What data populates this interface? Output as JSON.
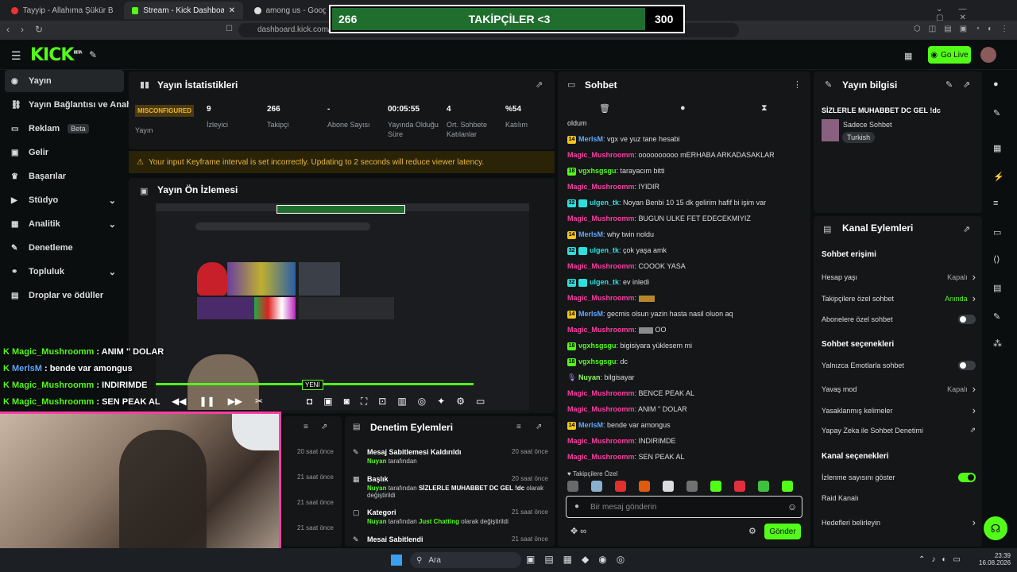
{
  "browser": {
    "tabs": [
      {
        "label": "Tayyip - Allahıma Şükür Bugün de"
      },
      {
        "label": "Stream - Kick Dashboard"
      },
      {
        "label": "among us - Google'da Ar"
      }
    ],
    "url": "dashboard.kick.com/str"
  },
  "follower_goal": {
    "current": "266",
    "label": "TAKİPÇİLER <3",
    "target": "300",
    "progress": 0.887
  },
  "topbar": {
    "logo": "KICK",
    "logo_sup": "BETA",
    "go_live": "Go Live"
  },
  "sidebar": {
    "items": [
      {
        "label": "Yayın",
        "icon": "broadcast-icon"
      },
      {
        "label": "Yayın Bağlantısı ve Anahtar",
        "icon": "link-icon"
      },
      {
        "label": "Reklam",
        "badge": "Beta",
        "icon": "ad-icon"
      },
      {
        "label": "Gelir",
        "icon": "revenue-icon"
      },
      {
        "label": "Başarılar",
        "icon": "trophy-icon"
      },
      {
        "label": "Stüdyo",
        "icon": "studio-icon"
      },
      {
        "label": "Analitik",
        "icon": "analytics-icon"
      },
      {
        "label": "Denetleme",
        "icon": "moderation-icon"
      },
      {
        "label": "Topluluk",
        "icon": "community-icon"
      },
      {
        "label": "Droplar ve ödüller",
        "icon": "drops-icon"
      }
    ]
  },
  "stats": {
    "title": "Yayın İstatistikleri",
    "status_badge": "MISCONFIGURED",
    "status_label": "Yayın",
    "items": [
      {
        "value": "9",
        "label": "İzleyici"
      },
      {
        "value": "266",
        "label": "Takipçi"
      },
      {
        "value": "-",
        "label": "Abone Sayısı"
      },
      {
        "value": "00:05:55",
        "label": "Yayında Olduğu Süre"
      },
      {
        "value": "4",
        "label": "Ort. Sohbete Katılanlar"
      },
      {
        "value": "%54",
        "label": "Katılım"
      }
    ],
    "warning": "Your input Keyframe interval is set incorrectly. Updating to 2 seconds will reduce viewer latency."
  },
  "preview": {
    "title": "Yayın Ön İzlemesi",
    "new_badge": "YENİ"
  },
  "overlay_chat": [
    {
      "user": "Magic_Mushroomm",
      "text": "ANIM \" DOLAR",
      "color": "green"
    },
    {
      "user": "MerlsM",
      "text": "bende var amongus",
      "color": "blue"
    },
    {
      "user": "Magic_Mushroomm",
      "text": "INDIRIMDE",
      "color": "green"
    },
    {
      "user": "Magic_Mushroomm",
      "text": "SEN PEAK AL",
      "color": "green"
    }
  ],
  "mod_history": {
    "times": [
      "20 saat önce",
      "21 saat önce",
      "21 saat önce",
      "21 saat önce"
    ]
  },
  "mod_actions": {
    "title": "Denetim Eylemleri",
    "items": [
      {
        "title": "Mesaj Sabitlemesi Kaldırıldı",
        "actor": "Nuyan",
        "suffix": "tarafından",
        "extra": "",
        "time": "20 saat önce"
      },
      {
        "title": "Başlık",
        "actor": "Nuyan",
        "suffix": "tarafından",
        "extra": "SİZLERLE MUHABBET DC GEL !dc",
        "extra2": "olarak değiştirildi",
        "time": "20 saat önce"
      },
      {
        "title": "Kategori",
        "actor": "Nuyan",
        "suffix": "tarafından",
        "extra": "Just Chatting",
        "extra2": "olarak değiştirildi",
        "time": "21 saat önce"
      },
      {
        "title": "Mesai Sabitlendi",
        "actor": "",
        "suffix": "",
        "extra": "",
        "time": "21 saat önce"
      }
    ]
  },
  "chat": {
    "title": "Sohbet",
    "first_line": "oldum",
    "messages": [
      {
        "badge": "14",
        "user": "MerlsM",
        "text": "vgx ve yuz tane hesabi",
        "color": "blue"
      },
      {
        "badge": "",
        "user": "Magic_Mushroomm",
        "text": "oooooooooo mERHABA ARKADASAKLAR",
        "color": "pink"
      },
      {
        "badge": "18",
        "user": "vgxhsgsgu",
        "text": "tarayacım bitti",
        "color": "green"
      },
      {
        "badge": "",
        "user": "Magic_Mushroomm",
        "text": "IYIDIR",
        "color": "pink"
      },
      {
        "badge": "32",
        "user": "ulgen_tk",
        "text": "Noyan Benbi 10 15 dk gelirim hafif bi işim var",
        "color": "cyan"
      },
      {
        "badge": "",
        "user": "Magic_Mushroomm",
        "text": "BUGUN ULKE FET EDECEKMIYIZ",
        "color": "pink"
      },
      {
        "badge": "14",
        "user": "MerlsM",
        "text": "why twin noldu",
        "color": "blue"
      },
      {
        "badge": "32",
        "user": "ulgen_tk",
        "text": "çok yaşa amk",
        "color": "cyan"
      },
      {
        "badge": "",
        "user": "Magic_Mushroomm",
        "text": "COOOK YASA",
        "color": "pink"
      },
      {
        "badge": "32",
        "user": "ulgen_tk",
        "text": "ev inledi",
        "color": "cyan"
      },
      {
        "badge": "",
        "user": "Magic_Mushroomm",
        "text": "",
        "color": "pink"
      },
      {
        "badge": "14",
        "user": "MerlsM",
        "text": "gecmis olsun yazin hasta nasil oluon aq",
        "color": "blue"
      },
      {
        "badge": "",
        "user": "Magic_Mushroomm",
        "text": "OO",
        "color": "pink"
      },
      {
        "badge": "18",
        "user": "vgxhsgsgu",
        "text": "bigisiyara yüklesem mi",
        "color": "green"
      },
      {
        "badge": "18",
        "user": "vgxhsgsgu",
        "text": "dc",
        "color": "green"
      },
      {
        "badge": "",
        "user": "Nuyan",
        "text": "bilgisayar",
        "color": "lime"
      },
      {
        "badge": "",
        "user": "Magic_Mushroomm",
        "text": "BENCE PEAK AL",
        "color": "pink"
      },
      {
        "badge": "",
        "user": "Magic_Mushroomm",
        "text": "ANIM \" DOLAR",
        "color": "pink"
      },
      {
        "badge": "14",
        "user": "MerlsM",
        "text": "bende var amongus",
        "color": "blue"
      },
      {
        "badge": "",
        "user": "Magic_Mushroomm",
        "text": "INDIRIMDE",
        "color": "pink"
      },
      {
        "badge": "",
        "user": "Magic_Mushroomm",
        "text": "SEN PEAK AL",
        "color": "pink"
      }
    ],
    "emotes_label": "Takipçilere Özel",
    "input_placeholder": "Bir mesaj gönderin",
    "send": "Gönder"
  },
  "stream_info": {
    "title": "Yayın bilgisi",
    "stream_title": "SİZLERLE MUHABBET DC GEL !dc",
    "category": "Sadece Sohbet",
    "tag": "Turkish"
  },
  "channel_actions": {
    "title": "Kanal Eylemleri",
    "chat_access": "Sohbet erişimi",
    "rows_access": [
      {
        "label": "Hesap yaşı",
        "value": "Kapalı",
        "type": "chevron"
      },
      {
        "label": "Takipçilere özel sohbet",
        "value": "Anında",
        "type": "chevron-green"
      },
      {
        "label": "Abonelere özel sohbet",
        "value": "",
        "type": "toggle-off"
      }
    ],
    "chat_options": "Sohbet seçenekleri",
    "rows_options": [
      {
        "label": "Yalnızca Emotlarla sohbet",
        "value": "",
        "type": "toggle-off"
      },
      {
        "label": "Yavaş mod",
        "value": "Kapalı",
        "type": "chevron"
      },
      {
        "label": "Yasaklanmış kelimeler",
        "value": "",
        "type": "chevron"
      },
      {
        "label": "Yapay Zeka ile Sohbet Denetimi",
        "value": "",
        "type": "external"
      }
    ],
    "channel_options": "Kanal seçenekleri",
    "rows_channel": [
      {
        "label": "İzlenme sayısını göster",
        "value": "",
        "type": "toggle-on"
      },
      {
        "label": "Raid Kanalı",
        "value": "",
        "type": "none"
      },
      {
        "label": "Hedefleri belirleyin",
        "value": "",
        "type": "chevron"
      }
    ]
  },
  "taskbar": {
    "search": "Ara",
    "time": "23:39",
    "date": "16.08.2026"
  },
  "colors": {
    "accent": "#53fc18",
    "pink": "#ff3da5",
    "panel": "#141618",
    "warning": "#e9b93c"
  }
}
